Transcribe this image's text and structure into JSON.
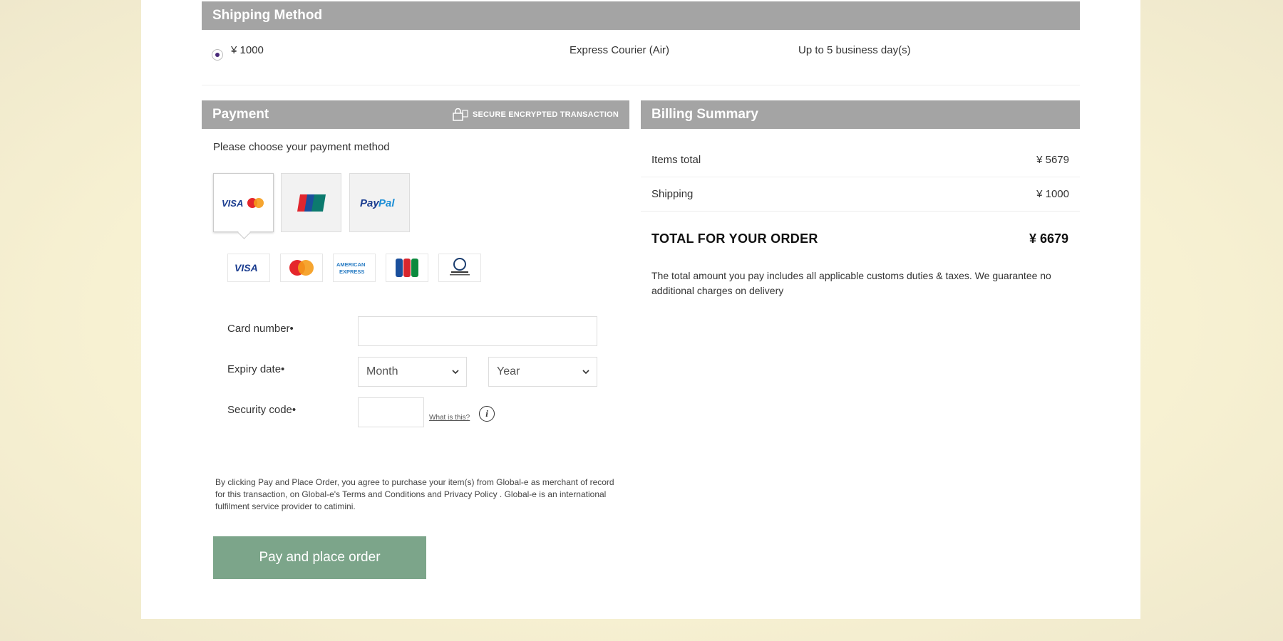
{
  "shipping": {
    "header": "Shipping Method",
    "option": {
      "price": "¥ 1000",
      "carrier": "Express Courier (Air)",
      "eta": "Up to 5 business day(s)"
    }
  },
  "payment": {
    "header": "Payment",
    "secure_badge": "SECURE ENCRYPTED TRANSACTION",
    "choose_prompt": "Please choose your payment method",
    "methods": [
      "Visa / MasterCard",
      "UnionPay",
      "PayPal"
    ],
    "selected_method": "Visa / MasterCard",
    "card_brands": [
      "VISA",
      "MasterCard",
      "AMERICAN EXPRESS",
      "JCB",
      "Diners Club"
    ],
    "card_number_label": "Card number",
    "expiry_label": "Expiry date",
    "month_value": "Month",
    "year_value": "Year",
    "security_label": "Security code",
    "what_is_this": "What is this?",
    "required_marker": "•",
    "legal_text": "By clicking Pay and Place Order, you agree to purchase your item(s) from Global-e as merchant of record for this transaction, on Global-e's  Terms and Conditions  and  Privacy Policy . Global-e is an international fulfilment service provider to catimini.",
    "pay_button": "Pay and place order",
    "button_color": "#7ca58a"
  },
  "billing": {
    "header": "Billing Summary",
    "items_total_label": "Items total",
    "items_total_value": "¥ 5679",
    "shipping_label": "Shipping",
    "shipping_value": "¥ 1000",
    "total_label": "TOTAL FOR YOUR ORDER",
    "total_value": "¥ 6679",
    "note": "The total amount you pay includes all applicable customs duties & taxes. We guarantee no additional charges on delivery"
  },
  "colors": {
    "header_bar": "#a4a4a4",
    "page_bg": "#fbf6dd"
  }
}
